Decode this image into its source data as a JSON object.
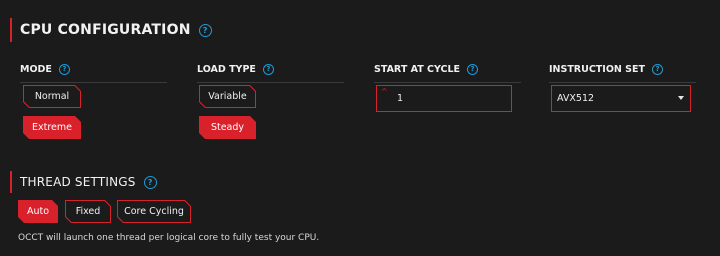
{
  "cpu": {
    "title": "CPU CONFIGURATION",
    "mode": {
      "label": "MODE",
      "options": [
        "Normal",
        "Extreme"
      ],
      "selected": "Extreme"
    },
    "load_type": {
      "label": "LOAD TYPE",
      "options": [
        "Variable",
        "Steady"
      ],
      "selected": "Steady"
    },
    "start_cycle": {
      "label": "START AT CYCLE",
      "value": "1"
    },
    "instruction_set": {
      "label": "INSTRUCTION SET",
      "value": "AVX512"
    }
  },
  "thread": {
    "title": "THREAD SETTINGS",
    "options": [
      "Auto",
      "Fixed",
      "Core Cycling"
    ],
    "selected": "Auto",
    "note": "OCCT will launch one thread per logical core to fully test your CPU."
  },
  "icons": {
    "help": "question-circle-icon",
    "dropdown": "chevron-down-icon",
    "spinner_up": "caret-up-icon"
  },
  "colors": {
    "accent": "#d9212c",
    "help": "#1e9bd7",
    "background": "#1b1b1c"
  }
}
